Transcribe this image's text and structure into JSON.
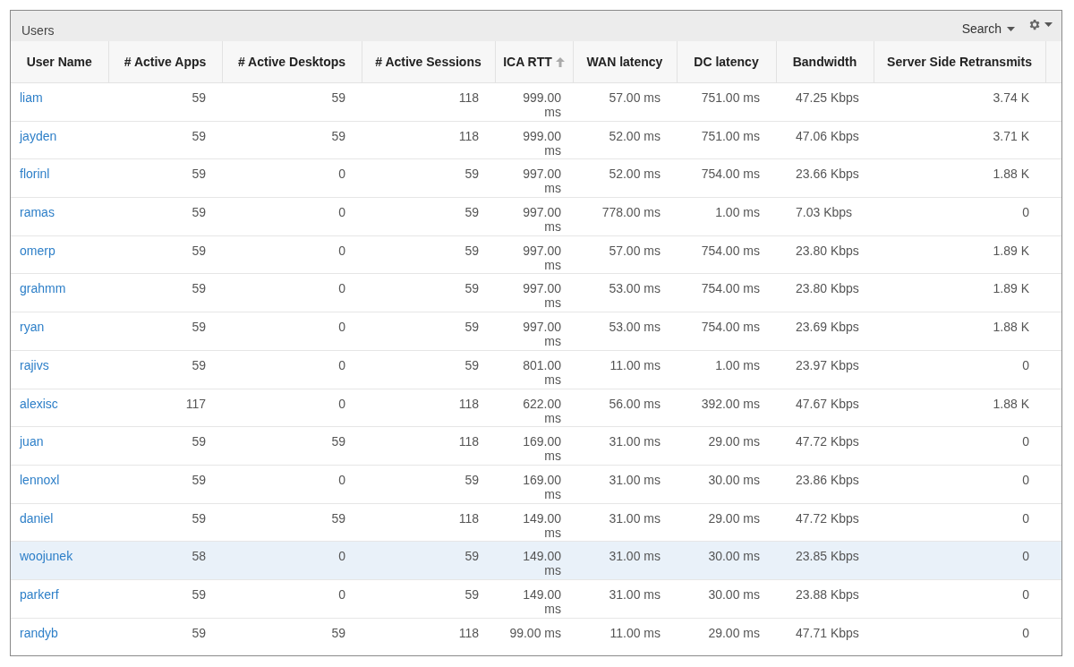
{
  "panel": {
    "title": "Users",
    "search_label": "Search"
  },
  "table": {
    "columns": [
      {
        "label": "User Name",
        "sorted": false
      },
      {
        "label": "# Active Apps",
        "sorted": false
      },
      {
        "label": "# Active Desktops",
        "sorted": false
      },
      {
        "label": "# Active Sessions",
        "sorted": false
      },
      {
        "label": "ICA RTT",
        "sorted": true
      },
      {
        "label": "WAN latency",
        "sorted": false
      },
      {
        "label": "DC latency",
        "sorted": false
      },
      {
        "label": "Bandwidth",
        "sorted": false
      },
      {
        "label": "Server Side Retransmits",
        "sorted": false
      }
    ],
    "rows": [
      {
        "selected": false,
        "cells": [
          "liam",
          "59",
          "59",
          "118",
          "999.00 ms",
          "57.00 ms",
          "751.00 ms",
          "47.25 Kbps",
          "3.74 K"
        ]
      },
      {
        "selected": false,
        "cells": [
          "jayden",
          "59",
          "59",
          "118",
          "999.00 ms",
          "52.00 ms",
          "751.00 ms",
          "47.06 Kbps",
          "3.71 K"
        ]
      },
      {
        "selected": false,
        "cells": [
          "florinl",
          "59",
          "0",
          "59",
          "997.00 ms",
          "52.00 ms",
          "754.00 ms",
          "23.66 Kbps",
          "1.88 K"
        ]
      },
      {
        "selected": false,
        "cells": [
          "ramas",
          "59",
          "0",
          "59",
          "997.00 ms",
          "778.00 ms",
          "1.00 ms",
          "7.03 Kbps",
          "0"
        ]
      },
      {
        "selected": false,
        "cells": [
          "omerp",
          "59",
          "0",
          "59",
          "997.00 ms",
          "57.00 ms",
          "754.00 ms",
          "23.80 Kbps",
          "1.89 K"
        ]
      },
      {
        "selected": false,
        "cells": [
          "grahmm",
          "59",
          "0",
          "59",
          "997.00 ms",
          "53.00 ms",
          "754.00 ms",
          "23.80 Kbps",
          "1.89 K"
        ]
      },
      {
        "selected": false,
        "cells": [
          "ryan",
          "59",
          "0",
          "59",
          "997.00 ms",
          "53.00 ms",
          "754.00 ms",
          "23.69 Kbps",
          "1.88 K"
        ]
      },
      {
        "selected": false,
        "cells": [
          "rajivs",
          "59",
          "0",
          "59",
          "801.00 ms",
          "11.00 ms",
          "1.00 ms",
          "23.97 Kbps",
          "0"
        ]
      },
      {
        "selected": false,
        "cells": [
          "alexisc",
          "117",
          "0",
          "118",
          "622.00 ms",
          "56.00 ms",
          "392.00 ms",
          "47.67 Kbps",
          "1.88 K"
        ]
      },
      {
        "selected": false,
        "cells": [
          "juan",
          "59",
          "59",
          "118",
          "169.00 ms",
          "31.00 ms",
          "29.00 ms",
          "47.72 Kbps",
          "0"
        ]
      },
      {
        "selected": false,
        "cells": [
          "lennoxl",
          "59",
          "0",
          "59",
          "169.00 ms",
          "31.00 ms",
          "30.00 ms",
          "23.86 Kbps",
          "0"
        ]
      },
      {
        "selected": false,
        "cells": [
          "daniel",
          "59",
          "59",
          "118",
          "149.00 ms",
          "31.00 ms",
          "29.00 ms",
          "47.72 Kbps",
          "0"
        ]
      },
      {
        "selected": true,
        "cells": [
          "woojunek",
          "58",
          "0",
          "59",
          "149.00 ms",
          "31.00 ms",
          "30.00 ms",
          "23.85 Kbps",
          "0"
        ]
      },
      {
        "selected": false,
        "cells": [
          "parkerf",
          "59",
          "0",
          "59",
          "149.00 ms",
          "31.00 ms",
          "30.00 ms",
          "23.88 Kbps",
          "0"
        ]
      },
      {
        "selected": false,
        "cells": [
          "randyb",
          "59",
          "59",
          "118",
          "99.00 ms",
          "11.00 ms",
          "29.00 ms",
          "47.71 Kbps",
          "0"
        ]
      }
    ]
  }
}
